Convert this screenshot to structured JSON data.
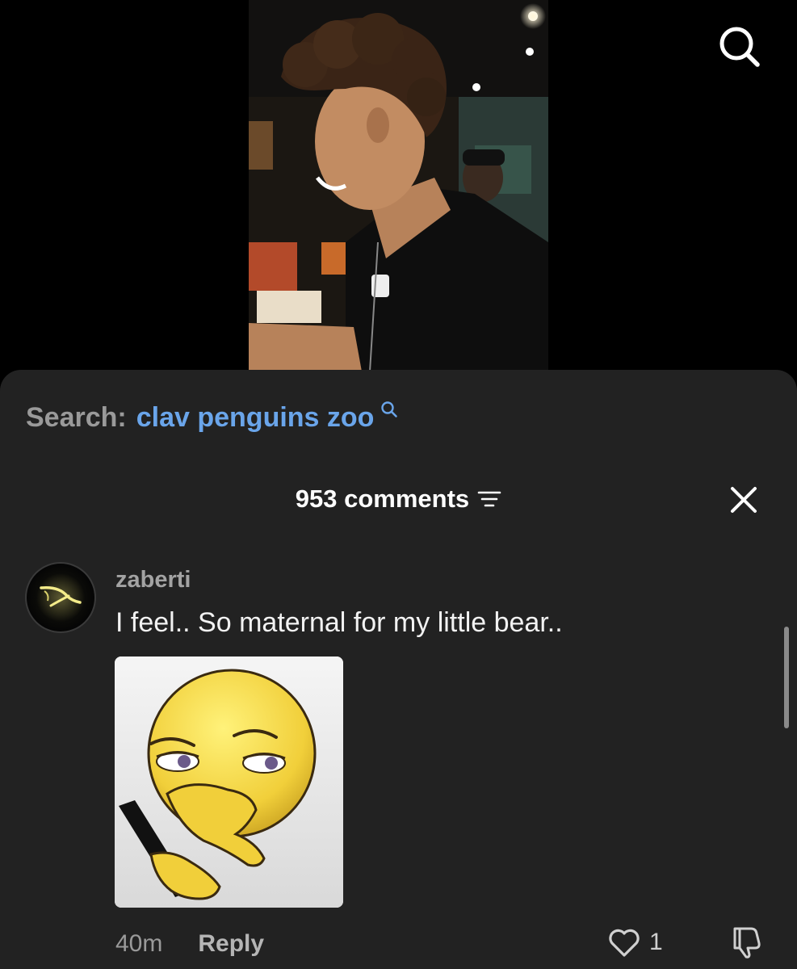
{
  "search": {
    "label": "Search:",
    "query": "clav penguins zoo"
  },
  "comments": {
    "count_label": "953 comments"
  },
  "comment": {
    "username": "zaberti",
    "text": "I feel.. So maternal for my little bear..",
    "time": "40m",
    "reply_label": "Reply",
    "like_count": "1"
  },
  "icons": {
    "top_search": "search-icon",
    "sort": "sort-lines-icon",
    "close": "close-icon",
    "like": "heart-icon",
    "dislike": "thumbs-down-icon"
  },
  "colors": {
    "sheet_bg": "#222222",
    "query_link": "#6aa5ea",
    "muted_text": "#9a9a9a"
  }
}
